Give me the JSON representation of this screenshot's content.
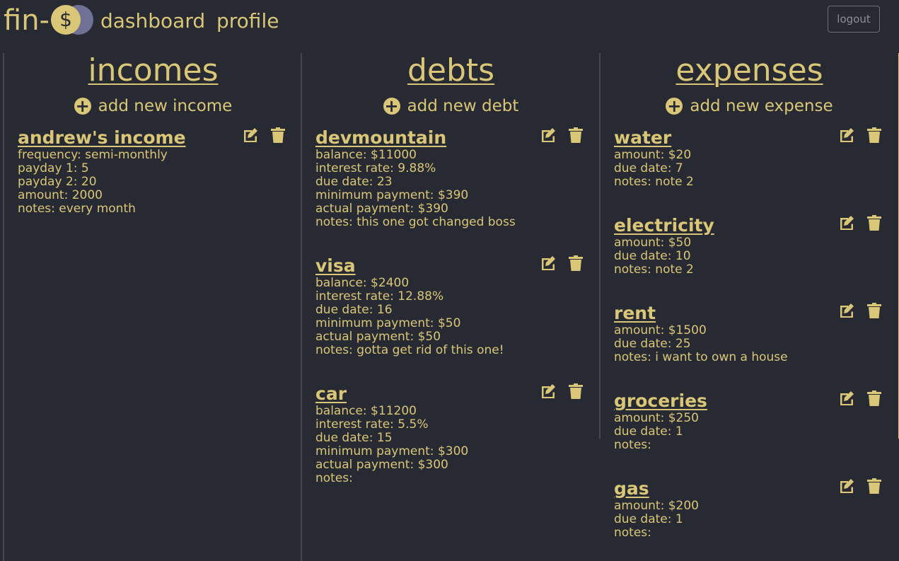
{
  "nav": {
    "brand": "fin-",
    "logo_symbol": "$",
    "links": [
      "dashboard",
      "profile"
    ],
    "logout": "logout"
  },
  "colors": {
    "background": "#272a33",
    "accent": "#d9c677",
    "logo_shadow": "#6f7294"
  },
  "columns": {
    "incomes": {
      "title": "incomes",
      "add_label": "add new income",
      "items": [
        {
          "name": "andrew's income",
          "lines": [
            "frequency: semi-monthly",
            "payday 1: 5",
            "payday 2: 20",
            "amount: 2000",
            "notes: every month"
          ]
        }
      ]
    },
    "debts": {
      "title": "debts",
      "add_label": "add new debt",
      "items": [
        {
          "name": "devmountain",
          "lines": [
            "balance: $11000",
            "interest rate: 9.88%",
            "due date: 23",
            "minimum payment: $390",
            "actual payment: $390",
            "notes: this one got changed boss"
          ]
        },
        {
          "name": "visa",
          "lines": [
            "balance: $2400",
            "interest rate: 12.88%",
            "due date: 16",
            "minimum payment: $50",
            "actual payment: $50",
            "notes: gotta get rid of this one!"
          ]
        },
        {
          "name": "car",
          "lines": [
            "balance: $11200",
            "interest rate: 5.5%",
            "due date: 15",
            "minimum payment: $300",
            "actual payment: $300",
            "notes:"
          ]
        }
      ]
    },
    "expenses": {
      "title": "expenses",
      "add_label": "add new expense",
      "items": [
        {
          "name": "water",
          "lines": [
            "amount: $20",
            "due date: 7",
            "notes: note 2"
          ]
        },
        {
          "name": "electricity",
          "lines": [
            "amount: $50",
            "due date: 10",
            "notes: note 2"
          ]
        },
        {
          "name": "rent",
          "lines": [
            "amount: $1500",
            "due date: 25",
            "notes: i want to own a house"
          ]
        },
        {
          "name": "groceries",
          "lines": [
            "amount: $250",
            "due date: 1",
            "notes:"
          ]
        },
        {
          "name": "gas",
          "lines": [
            "amount: $200",
            "due date: 1",
            "notes:"
          ]
        }
      ]
    }
  },
  "icons": {
    "edit": "edit-icon",
    "delete": "trash-icon",
    "add": "plus-circle-icon"
  }
}
